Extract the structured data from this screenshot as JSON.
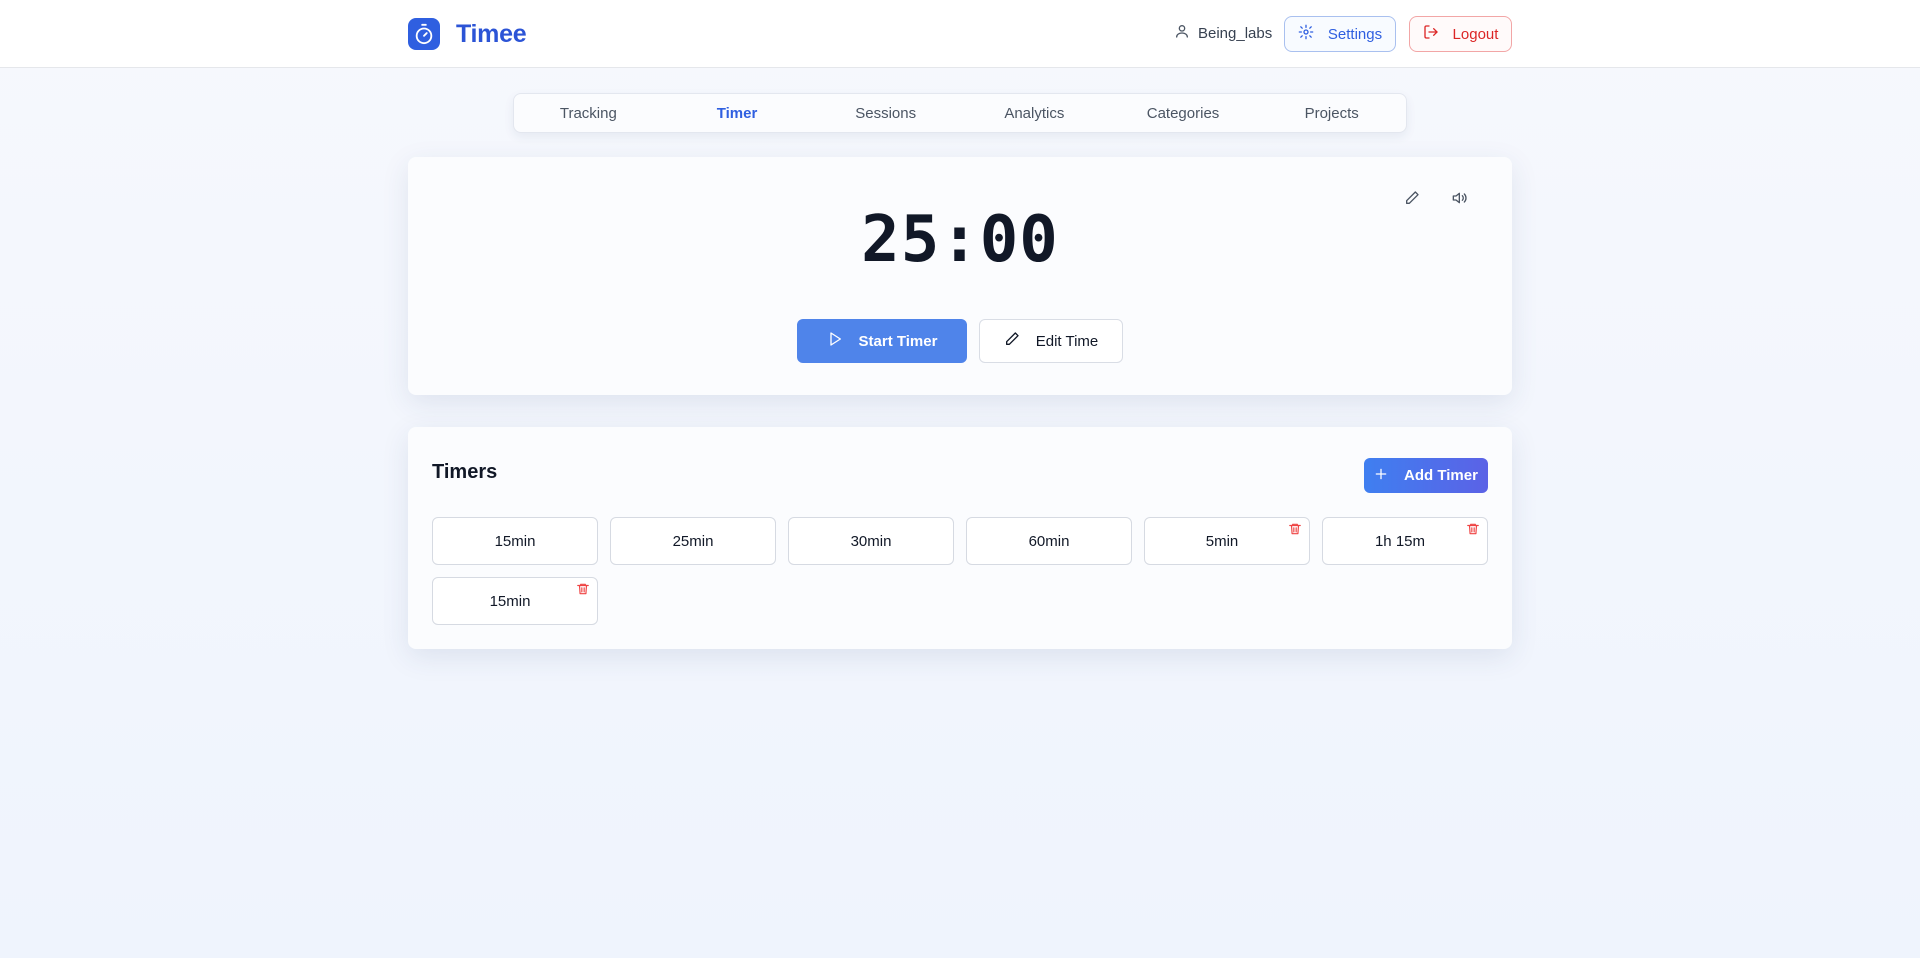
{
  "app": {
    "name": "Timee"
  },
  "header": {
    "username": "Being_labs",
    "settings_label": "Settings",
    "logout_label": "Logout"
  },
  "tabs": [
    {
      "label": "Tracking",
      "active": false
    },
    {
      "label": "Timer",
      "active": true
    },
    {
      "label": "Sessions",
      "active": false
    },
    {
      "label": "Analytics",
      "active": false
    },
    {
      "label": "Categories",
      "active": false
    },
    {
      "label": "Projects",
      "active": false
    }
  ],
  "timer": {
    "display": "25:00",
    "start_label": "Start Timer",
    "edit_label": "Edit Time"
  },
  "timers": {
    "title": "Timers",
    "add_label": "Add Timer",
    "items": [
      {
        "label": "15min",
        "deletable": false
      },
      {
        "label": "25min",
        "deletable": false
      },
      {
        "label": "30min",
        "deletable": false
      },
      {
        "label": "60min",
        "deletable": false
      },
      {
        "label": "5min",
        "deletable": true
      },
      {
        "label": "1h 15m",
        "deletable": true
      },
      {
        "label": "15min",
        "deletable": true
      }
    ]
  },
  "icons": {
    "logo": "stopwatch-icon",
    "user": "user-icon",
    "settings": "gear-icon",
    "logout": "logout-icon",
    "edit": "pencil-icon",
    "sound": "speaker-icon",
    "start": "play-icon",
    "add": "plus-icon",
    "delete": "trash-icon"
  },
  "colors": {
    "primary": "#2f5fe0",
    "start_button": "#4f84ea",
    "danger": "#dc2626",
    "background": "#f1f5fd"
  }
}
